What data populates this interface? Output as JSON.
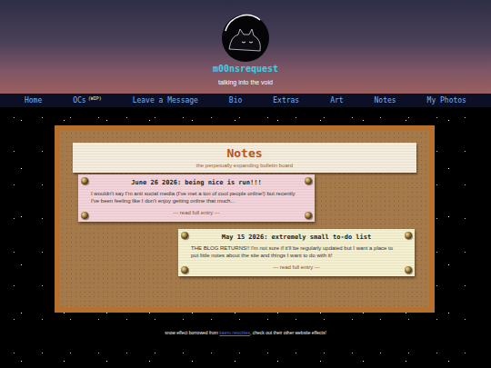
{
  "site": {
    "title": "m00nsrequest",
    "tagline": "talking into the void"
  },
  "nav": [
    {
      "label": "Home",
      "badge": ""
    },
    {
      "label": "OCs",
      "badge": "(WIP)"
    },
    {
      "label": "Leave a Message",
      "badge": ""
    },
    {
      "label": "Bio",
      "badge": ""
    },
    {
      "label": "Extras",
      "badge": ""
    },
    {
      "label": "Art",
      "badge": ""
    },
    {
      "label": "Notes",
      "badge": ""
    },
    {
      "label": "My Photos",
      "badge": ""
    }
  ],
  "page": {
    "title": "Notes",
    "subtitle": "the perpetually expanding bulletin board"
  },
  "notes": [
    {
      "title": "June 26 2026: being nice is run!!!",
      "excerpt": "I wouldn't say I'm anti social media (I've met a ton of cool people online!) but recently I've been feeling like I don't enjoy getting online that much...",
      "link": "--- read full entry ---",
      "color": "#f3d3da"
    },
    {
      "title": "May 15 2026: extremely small to-do list",
      "excerpt": "THE BLOG RETURNS!! I'm not sure if it'll be regularly updated but I want a place to put little notes about the site and things I want to do with it!",
      "link": "--- read full entry ---",
      "color": "#f4efcf"
    }
  ],
  "footer": {
    "before": "snow effect borrowed from ",
    "link": "kaeru.neocities",
    "after": ", check out their other website effects!"
  }
}
